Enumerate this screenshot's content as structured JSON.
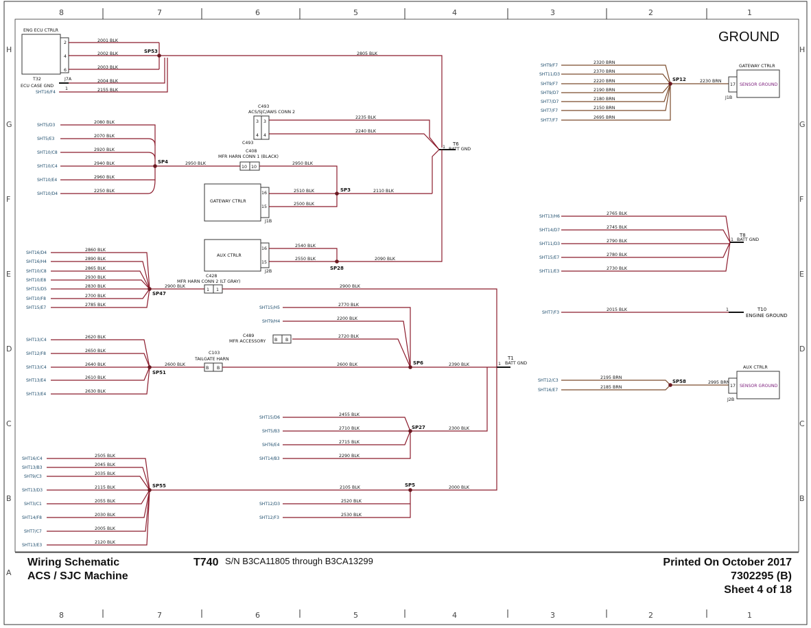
{
  "page_heading": "GROUND",
  "title_block": {
    "line1": "Wiring Schematic",
    "line2": "ACS / SJC Machine",
    "model": "T740",
    "serial": "S/N B3CA11805 through B3CA13299",
    "printed": "Printed On October 2017",
    "doc_no": "7302295 (B)",
    "sheet": "Sheet 4 of 18"
  },
  "grid": {
    "columns": [
      "8",
      "7",
      "6",
      "5",
      "4",
      "3",
      "2",
      "1"
    ],
    "rows": [
      "H",
      "G",
      "F",
      "E",
      "D",
      "C",
      "B",
      "A"
    ]
  },
  "components": {
    "eng_ecu": "ENG ECU CTRLR",
    "t32": "T32",
    "ecu_case_gnd": "ECU CASE GND",
    "j7a": "J7A",
    "c493_name": "C493",
    "c493_desc": "ACS/SJC/AWS CONN 2",
    "c408_name": "C408",
    "c408_desc": "MFR HARN CONN 1 (BLACK)",
    "gateway_ctrlr": "GATEWAY CTRLR",
    "j1b": "J1B",
    "aux_ctrlr": "AUX CTRLR",
    "j2b": "J2B",
    "c428_name": "C428",
    "c428_desc": "MFR HARN CONN 2 (LT GRAY)",
    "c489_name": "C489",
    "c489_desc": "MFR ACCESSORY",
    "c103_name": "C103",
    "c103_desc": "TAILGATE HARN",
    "sensor_ground": "SENSOR GROUND",
    "t6": "T6",
    "t8": "T8",
    "t1": "T1",
    "batt_gnd": "BATT GND",
    "t10": "T10",
    "engine_ground": "ENGINE GROUND"
  },
  "splices": [
    "SP53",
    "SP4",
    "SP3",
    "SP28",
    "SP47",
    "SP51",
    "SP6",
    "SP27",
    "SP55",
    "SP5",
    "SP12",
    "SP58"
  ],
  "pins": {
    "p2": "2",
    "p4": "4",
    "p6": "6",
    "p1": "1",
    "p3": "3",
    "p10": "10",
    "p16": "16",
    "p15": "15",
    "p17": "17",
    "pb": "B"
  },
  "wires": {
    "w2001": "2001 BLK",
    "w2002": "2002 BLK",
    "w2003": "2003 BLK",
    "w2004": "2004 BLK",
    "w2155": "2155 BLK",
    "w2805": "2805 BLK",
    "w2080": "2080 BLK",
    "w2070": "2070 BLK",
    "w2920": "2920 BLK",
    "w2940": "2940 BLK",
    "w2960": "2960 BLK",
    "w2250": "2250 BLK",
    "w2950a": "2950 BLK",
    "w2950b": "2950 BLK",
    "w2235": "2235 BLK",
    "w2240": "2240 BLK",
    "w2510": "2510 BLK",
    "w2500": "2500 BLK",
    "w2110": "2110 BLK",
    "w2540": "2540 BLK",
    "w2550": "2550 BLK",
    "w2090": "2090 BLK",
    "w2860": "2860 BLK",
    "w2890": "2890 BLK",
    "w2865": "2865 BLK",
    "w2930": "2930 BLK",
    "w2830": "2830 BLK",
    "w2700": "2700 BLK",
    "w2785": "2785 BLK",
    "w2900a": "2900 BLK",
    "w2900b": "2900 BLK",
    "w2770": "2770 BLK",
    "w2200": "2200 BLK",
    "w2720": "2720 BLK",
    "w2620": "2620 BLK",
    "w2650": "2650 BLK",
    "w2640": "2640 BLK",
    "w2610": "2610 BLK",
    "w2630": "2630 BLK",
    "w2600a": "2600 BLK",
    "w2600b": "2600 BLK",
    "w2390": "2390 BLK",
    "w2455": "2455 BLK",
    "w2710": "2710 BLK",
    "w2715": "2715 BLK",
    "w2290": "2290 BLK",
    "w2300": "2300 BLK",
    "w2505": "2505 BLK",
    "w2045": "2045 BLK",
    "w2035": "2035 BLK",
    "w2115": "2115 BLK",
    "w2055": "2055 BLK",
    "w2030": "2030 BLK",
    "w2005": "2005 BLK",
    "w2120": "2120 BLK",
    "w2105": "2105 BLK",
    "w2000": "2000 BLK",
    "w2520": "2520 BLK",
    "w2530": "2530 BLK",
    "w2320": "2320 BRN",
    "w2370": "2370 BRN",
    "w2220": "2220 BRN",
    "w2190": "2190 BRN",
    "w2180": "2180 BRN",
    "w2150": "2150 BRN",
    "w2695": "2695 BRN",
    "w2230": "2230 BRN",
    "w2765": "2765 BLK",
    "w2745": "2745 BLK",
    "w2790": "2790 BLK",
    "w2780": "2780 BLK",
    "w2730": "2730 BLK",
    "w2015": "2015 BLK",
    "w2195": "2195 BRN",
    "w2185": "2185 BRN",
    "w2995": "2995 BRN"
  },
  "sheet_refs": {
    "r_sp53": "SHT16/F4",
    "r_sp4": [
      "SHT5/D3",
      "SHT5/E3",
      "SHT10/C8",
      "SHT10/C4",
      "SHT10/E4",
      "SHT10/D4"
    ],
    "r_sp47": [
      "SHT16/D4",
      "SHT16/H4",
      "SHT10/C8",
      "SHT10/E8",
      "SHT15/D5",
      "SHT10/F8",
      "SHT15/E7"
    ],
    "r_sp6": [
      "SHT15/H5",
      "SHT9/H4"
    ],
    "r_sp51": [
      "SHT13/C4",
      "SHT12/F8",
      "SHT13/C4",
      "SHT13/E4",
      "SHT13/E4"
    ],
    "r_sp27": [
      "SHT15/D6",
      "SHT5/B3",
      "SHT6/E4",
      "SHT14/B3"
    ],
    "r_sp55": [
      "SHT16/C4",
      "SHT13/B3",
      "SHT9/C3",
      "SHT13/D3",
      "SHT3/C1",
      "SHT14/F8",
      "SHT7/C7",
      "SHT13/E3"
    ],
    "r_sp5": [
      "SHT12/D3",
      "SHT12/F3"
    ],
    "r_sp12": [
      "SHT9/F7",
      "SHT11/D3",
      "SHT9/F7",
      "SHT9/D7",
      "SHT7/D7",
      "SHT7/F7",
      "SHT7/F7"
    ],
    "r_t8": [
      "SHT13/H6",
      "SHT14/D7",
      "SHT11/D3",
      "SHT15/E7",
      "SHT11/E3"
    ],
    "r_t10": "SHT7/F3",
    "r_sp58": [
      "SHT12/C3",
      "SHT16/E7"
    ]
  },
  "colors": {
    "wire_blk": "#8b1a2b",
    "wire_brn": "#7a4a2a",
    "splice": "#6b1a22",
    "sheet_ref": "#1a4a6a",
    "sensor": "#7a1a7a"
  }
}
